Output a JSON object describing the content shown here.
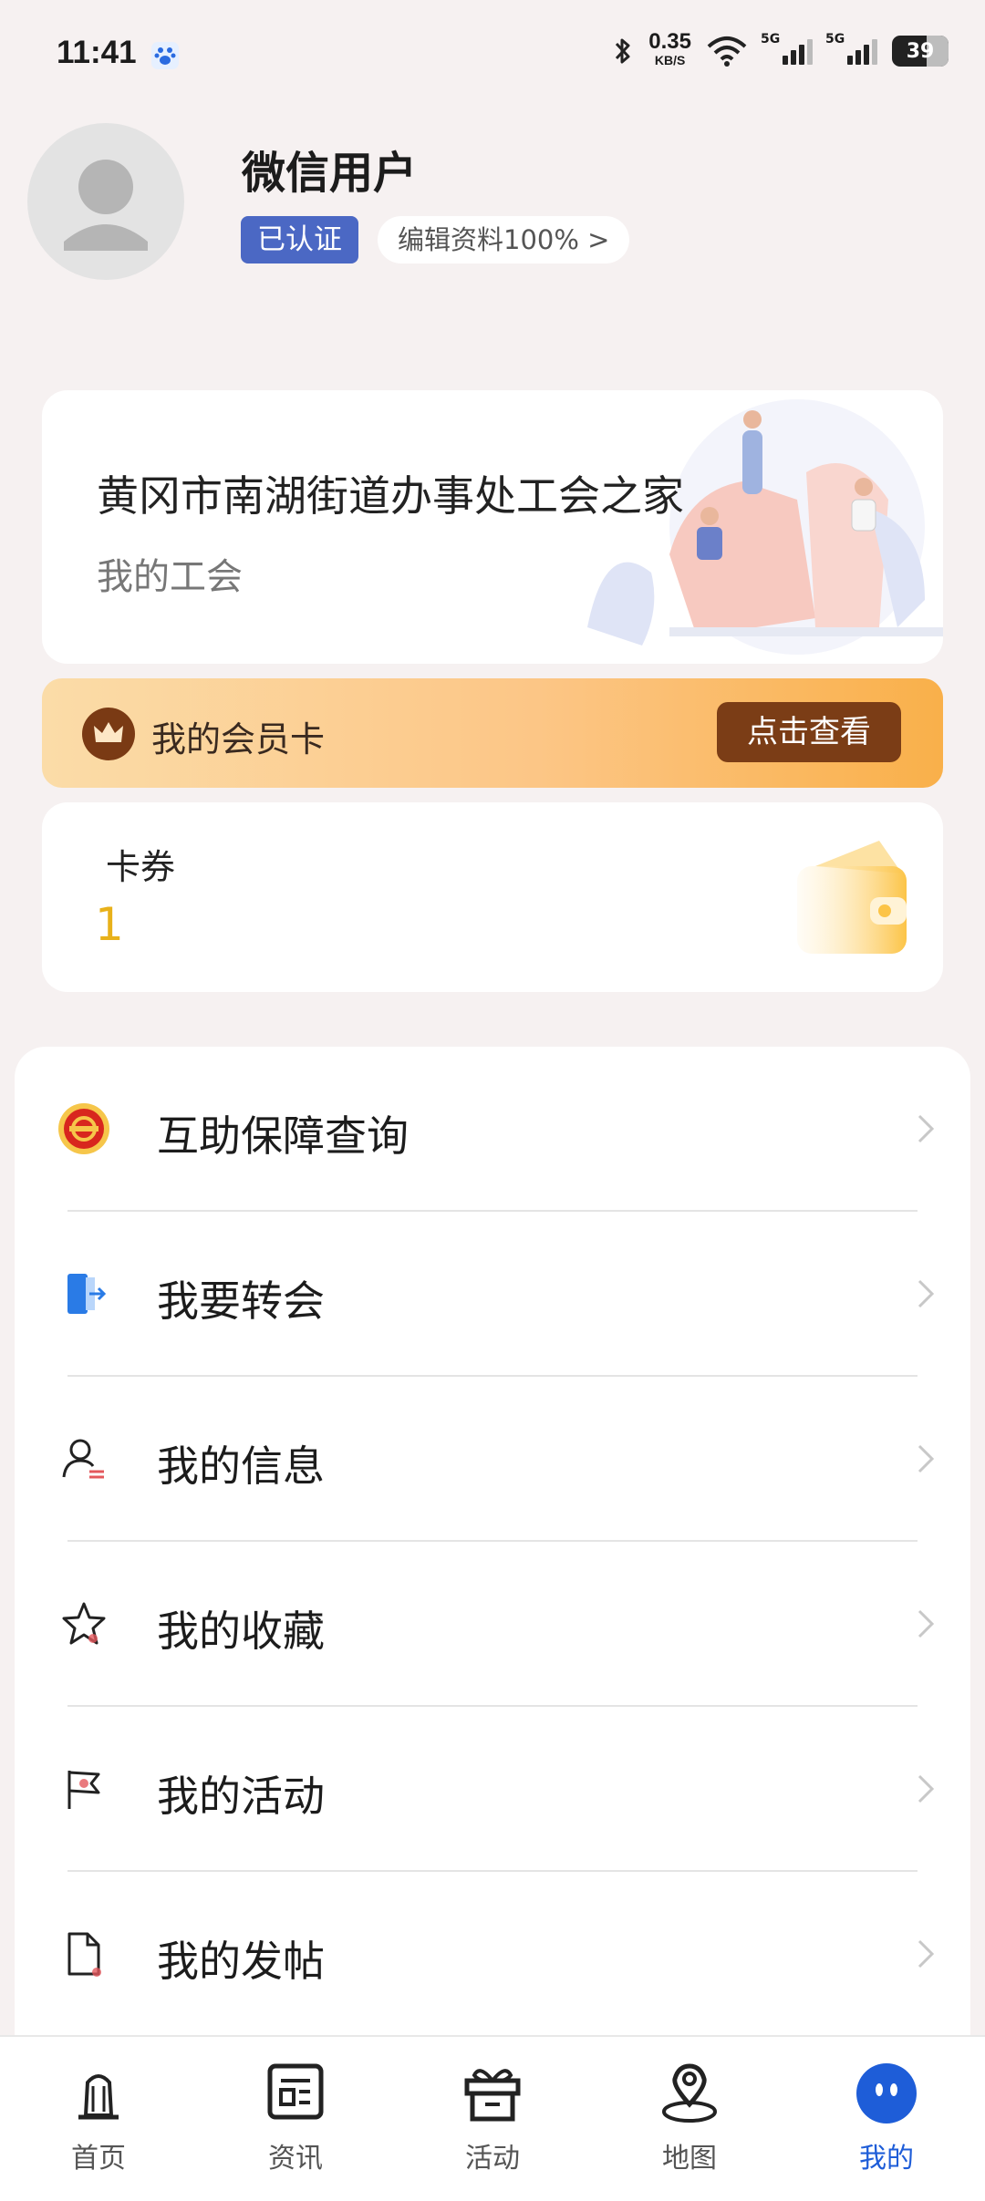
{
  "status_bar": {
    "time": "11:41",
    "net_speed": "0.35",
    "net_unit": "KB/S",
    "signal1_label": "5G",
    "signal2_label": "5G",
    "battery": "39"
  },
  "profile": {
    "username": "微信用户",
    "verified_badge": "已认证",
    "edit_profile": "编辑资料100% >"
  },
  "union_card": {
    "title": "黄冈市南湖街道办事处工会之家",
    "subtitle": "我的工会"
  },
  "member_card": {
    "label": "我的会员卡",
    "button": "点击查看"
  },
  "coupon": {
    "label": "卡券",
    "count": "1"
  },
  "menu": {
    "items": [
      {
        "label": "互助保障查询",
        "icon": "union-emblem-icon"
      },
      {
        "label": "我要转会",
        "icon": "door-transfer-icon"
      },
      {
        "label": "我的信息",
        "icon": "user-info-icon"
      },
      {
        "label": "我的收藏",
        "icon": "star-icon"
      },
      {
        "label": "我的活动",
        "icon": "flag-icon"
      },
      {
        "label": "我的发帖",
        "icon": "document-icon"
      }
    ]
  },
  "tabbar": {
    "tabs": [
      {
        "label": "首页",
        "icon": "home-tower-icon"
      },
      {
        "label": "资讯",
        "icon": "news-icon"
      },
      {
        "label": "活动",
        "icon": "gift-icon"
      },
      {
        "label": "地图",
        "icon": "map-pin-icon"
      },
      {
        "label": "我的",
        "icon": "profile-face-icon"
      }
    ],
    "active_index": 4
  },
  "colors": {
    "accent": "#1e5dd8",
    "verified_badge": "#4b68c4",
    "coupon_count": "#e8b11a",
    "member_button": "#7b3d16"
  }
}
